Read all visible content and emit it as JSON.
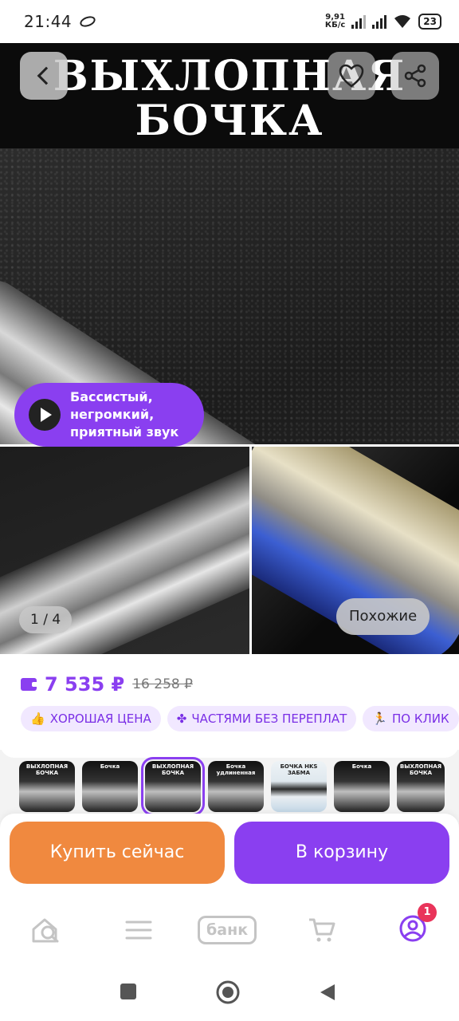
{
  "status_bar": {
    "time": "21:44",
    "speed_value": "9,91",
    "speed_unit": "КБ/с",
    "battery": "23"
  },
  "gallery": {
    "title_line1": "ВЫХЛОПНАЯ",
    "title_line2": "БОЧКА",
    "video_caption_line1": "Бассистый,",
    "video_caption_line2": "негромкий,",
    "video_caption_line3": "приятный звук",
    "counter": "1 / 4",
    "similar_label": "Похожие"
  },
  "product": {
    "price": "7 535 ₽",
    "old_price": "16 258 ₽",
    "badges": [
      {
        "icon": "thumbs-up-icon",
        "label": "ХОРОШАЯ ЦЕНА"
      },
      {
        "icon": "puzzle-icon",
        "label": "ЧАСТЯМИ БЕЗ ПЕРЕПЛАТ"
      },
      {
        "icon": "running-icon",
        "label": "ПО КЛИК"
      }
    ]
  },
  "thumbnails": [
    {
      "caption": "ВЫХЛОПНАЯ БОЧКА",
      "style": "dark"
    },
    {
      "caption": "Бочка",
      "style": "dark"
    },
    {
      "caption": "ВЫХЛОПНАЯ БОЧКА",
      "style": "dark"
    },
    {
      "caption": "Бочка удлиненная",
      "style": "dark"
    },
    {
      "caption": "БОЧКА HKS ЗАБМА",
      "style": "light"
    },
    {
      "caption": "Бочка",
      "style": "dark"
    },
    {
      "caption": "ВЫХЛОПНАЯ БОЧКА",
      "style": "dark"
    }
  ],
  "actions": {
    "buy_now": "Купить сейчас",
    "add_to_cart": "В корзину"
  },
  "tabbar": {
    "bank_label": "банк",
    "profile_badge": "1"
  },
  "colors": {
    "accent": "#8a3ff0",
    "buy_button": "#f0893f",
    "badge_bg": "#f1e8ff",
    "notification": "#e9345a"
  }
}
